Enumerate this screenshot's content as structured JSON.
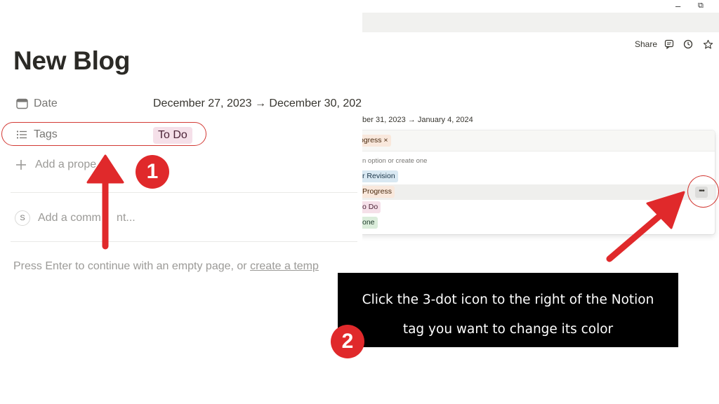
{
  "left_page": {
    "title": "New Blog",
    "properties": {
      "date": {
        "icon": "calendar-icon",
        "label": "Date",
        "value": "December 27, 2023 → December 30, 202"
      },
      "tags": {
        "icon": "list-icon",
        "label": "Tags",
        "value": "To Do"
      }
    },
    "add_property": "Add a prope",
    "comment": {
      "avatar_letter": "S",
      "placeholder": "Add a comm     nt..."
    },
    "empty_page_hint": {
      "text": "Press Enter to continue with an empty page, or ",
      "link": "create a temp"
    }
  },
  "right_page": {
    "window_controls": {
      "minimize": "–",
      "restore": "⧉"
    },
    "header_actions": {
      "share": "Share",
      "icons": [
        "comment-icon",
        "clock-icon",
        "star-icon"
      ]
    },
    "date_value": "ber 31, 2023 → January 4, 2024",
    "tag_popup": {
      "selected_chip": "ogress ×",
      "hint": "n option or create one",
      "options": [
        {
          "label": "r Revision",
          "bg": "#d9e8f2",
          "fg": "#183347"
        },
        {
          "label": " Progress",
          "bg": "#f9e8dc",
          "fg": "#49290e"
        },
        {
          "label": "o Do",
          "bg": "#f5e0e9",
          "fg": "#4c2337"
        },
        {
          "label": "one",
          "bg": "#dbeddb",
          "fg": "#1c3829"
        }
      ],
      "more_button": "•••"
    }
  },
  "annotations": {
    "step1": "1",
    "step2": "2",
    "instruction_line1": "Click the 3-dot icon to the right of the Notion",
    "instruction_line2": "tag you want to change its color"
  },
  "colors": {
    "annotation_red": "#e0292b",
    "tag_todo_bg": "#f5e0e9",
    "callout_bg": "#000000"
  }
}
